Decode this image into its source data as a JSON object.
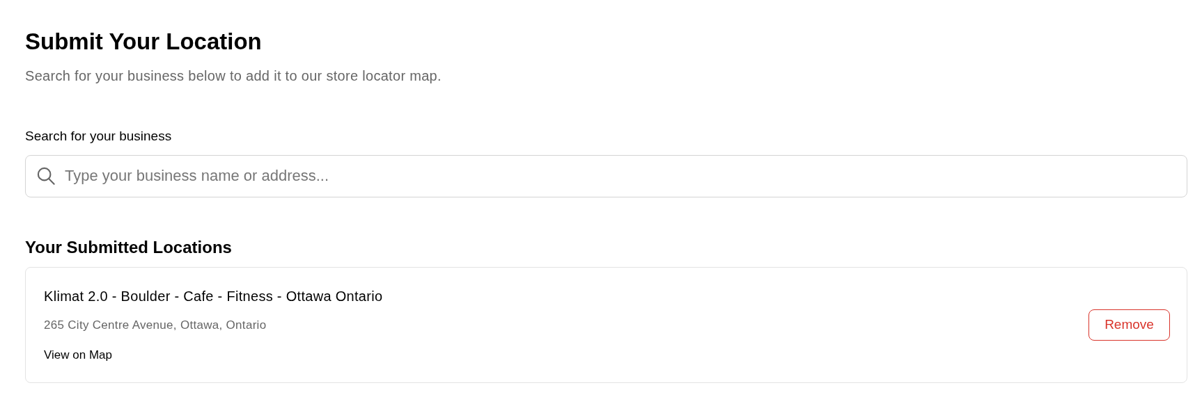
{
  "title": "Submit Your Location",
  "subtitle": "Search for your business below to add it to our store locator map.",
  "search": {
    "label": "Search for your business",
    "placeholder": "Type your business name or address..."
  },
  "submitted": {
    "heading": "Your Submitted Locations",
    "locations": [
      {
        "name": "Klimat 2.0 - Boulder - Cafe - Fitness - Ottawa Ontario",
        "address": "265 City Centre Avenue, Ottawa, Ontario",
        "link": "View on Map",
        "button": "Remove"
      }
    ]
  }
}
